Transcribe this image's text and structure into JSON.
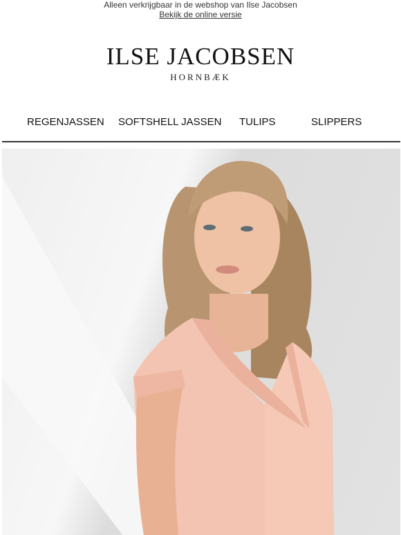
{
  "preheader": {
    "text": "Alleen verkrijgbaar in de webshop van Ilse Jacobsen",
    "link": "Bekijk de online versie"
  },
  "logo": {
    "brand": "ILSE JACOBSEN",
    "sub": "HORNBÆK"
  },
  "nav": {
    "items": [
      "REGENJASSEN",
      "SOFTSHELL JASSEN",
      "TULIPS",
      "SLIPPERS"
    ]
  },
  "hero": {
    "image": "woman-in-peach-v-neck-knit-top"
  }
}
